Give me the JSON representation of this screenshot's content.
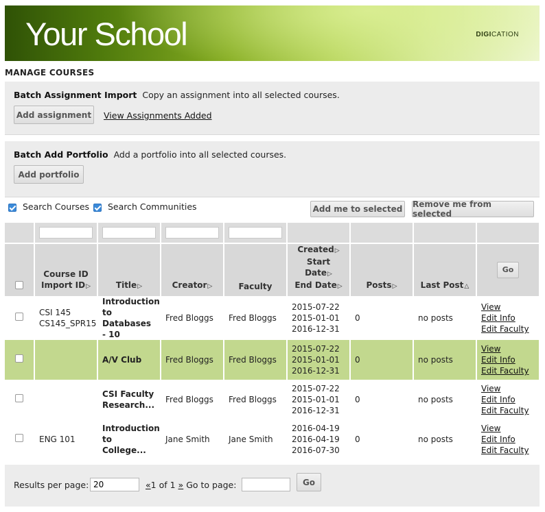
{
  "header": {
    "logo_text": "Your School",
    "brand_bold": "DIGI",
    "brand_rest": "CATION"
  },
  "page_title": "MANAGE COURSES",
  "batch_assignment": {
    "title": "Batch Assignment Import",
    "description": "Copy an assignment into all selected courses.",
    "add_button": "Add assignment",
    "view_link": "View Assignments Added"
  },
  "batch_portfolio": {
    "title": "Batch Add Portfolio",
    "description": "Add a portfolio into all selected courses.",
    "add_button": "Add portfolio"
  },
  "search": {
    "courses_label": "Search Courses",
    "courses_checked": true,
    "communities_label": "Search Communities",
    "communities_checked": true,
    "add_me_button": "Add me to selected",
    "remove_me_button": "Remove me from selected"
  },
  "table": {
    "headers": {
      "course_id": "Course ID",
      "import_id": "Import ID",
      "title": "Title",
      "creator": "Creator",
      "faculty": "Faculty",
      "created": "Created",
      "start_date": "Start Date",
      "end_date": "End Date",
      "posts": "Posts",
      "last_post": "Last Post",
      "go_button": "Go"
    },
    "rows": [
      {
        "course_id_line1": "CSI 145",
        "course_id_line2": "CS145_SPR15",
        "title": "Introduction to Databases - 10",
        "creator": "Fred Bloggs",
        "faculty": "Fred Bloggs",
        "created": "2015-07-22",
        "start": "2015-01-01",
        "end": "2016-12-31",
        "posts": "0",
        "last_post": "no posts",
        "view": "View",
        "edit_info": "Edit Info",
        "edit_faculty": "Edit Faculty"
      },
      {
        "course_id_line1": "",
        "course_id_line2": "",
        "title": "A/V Club",
        "creator": "Fred Bloggs",
        "faculty": "Fred Bloggs",
        "created": "2015-07-22",
        "start": "2015-01-01",
        "end": "2016-12-31",
        "posts": "0",
        "last_post": "no posts",
        "view": "View",
        "edit_info": "Edit Info",
        "edit_faculty": "Edit Faculty"
      },
      {
        "course_id_line1": "",
        "course_id_line2": "",
        "title": "CSI Faculty Research...",
        "creator": "Fred Bloggs",
        "faculty": "Fred Bloggs",
        "created": "2015-07-22",
        "start": "2015-01-01",
        "end": "2016-12-31",
        "posts": "0",
        "last_post": "no posts",
        "view": "View",
        "edit_info": "Edit Info",
        "edit_faculty": "Edit Faculty"
      },
      {
        "course_id_line1": "ENG 101",
        "course_id_line2": "",
        "title": "Introduction to College...",
        "creator": "Jane Smith",
        "faculty": "Jane Smith",
        "created": "2016-04-19",
        "start": "2016-04-19",
        "end": "2016-07-30",
        "posts": "0",
        "last_post": "no posts",
        "view": "View",
        "edit_info": "Edit Info",
        "edit_faculty": "Edit Faculty"
      }
    ]
  },
  "pagination": {
    "results_label": "Results per page:",
    "results_value": "20",
    "prev": "«",
    "page_info": "1 of 1",
    "next": "»",
    "goto_label": "Go to page:",
    "goto_value": "",
    "go_button": "Go"
  },
  "colors": {
    "highlight_row": "#c2d88e",
    "header_green_dark": "#2f5206",
    "header_green_light": "#edf6cf",
    "checkbox_blue": "#3b8ad9"
  }
}
